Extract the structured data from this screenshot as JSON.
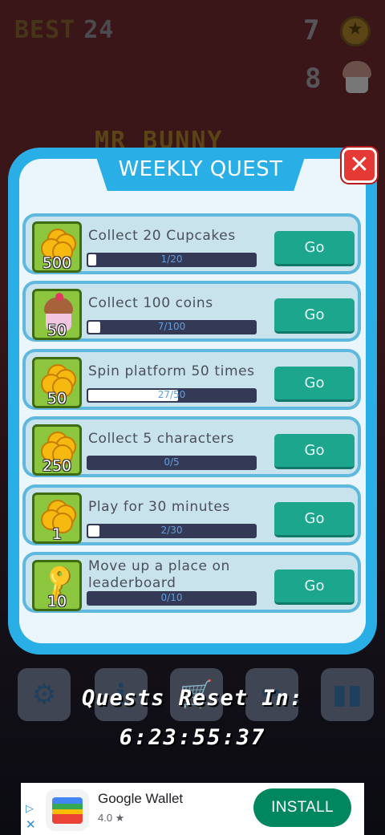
{
  "hud": {
    "best_label": "BEST",
    "best_value": "24",
    "coins": "7",
    "cupcakes": "8",
    "background_title": "MR BUNNY"
  },
  "modal": {
    "title": "WEEKLY QUEST",
    "close_label": "✕"
  },
  "quests": [
    {
      "reward_icon": "coins-icon",
      "reward_amount": "500",
      "text": "Collect 20 Cupcakes",
      "progress_text": "1/20",
      "progress": 0.05,
      "button": "Go"
    },
    {
      "reward_icon": "cupcake-icon",
      "reward_amount": "50",
      "text": "Collect 100 coins",
      "progress_text": "7/100",
      "progress": 0.07,
      "button": "Go"
    },
    {
      "reward_icon": "coins-icon",
      "reward_amount": "50",
      "text": "Spin platform 50 times",
      "progress_text": "27/50",
      "progress": 0.54,
      "button": "Go"
    },
    {
      "reward_icon": "coins-icon",
      "reward_amount": "250",
      "text": "Collect 5 characters",
      "progress_text": "0/5",
      "progress": 0.0,
      "button": "Go"
    },
    {
      "reward_icon": "coins-icon",
      "reward_amount": "1",
      "text": "Play for 30 minutes",
      "progress_text": "2/30",
      "progress": 0.067,
      "button": "Go"
    },
    {
      "reward_icon": "key-icon",
      "reward_amount": "10",
      "text": "Move up a place on leaderboard",
      "progress_text": "0/10",
      "progress": 0.0,
      "button": "Go"
    }
  ],
  "reset": {
    "label": "Quests Reset In:",
    "time": "6:23:55:37"
  },
  "menu_icons": [
    "gear-icon",
    "info-icon",
    "cart-icon",
    "share-icon",
    "leaderboard-icon"
  ],
  "ad": {
    "app_name": "Google Wallet",
    "rating": "4.0 ★",
    "install_label": "INSTALL"
  },
  "colors": {
    "modal_border": "#2aaee6",
    "go_button": "#1ba68d",
    "close_button": "#e53935",
    "reward_bg": "#8cc63f",
    "progress_track": "#343a56"
  }
}
